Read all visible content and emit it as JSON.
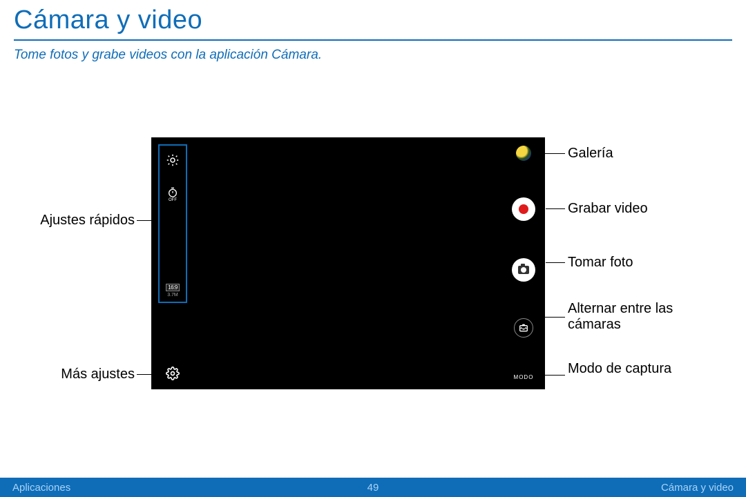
{
  "header": {
    "title": "Cámara y video",
    "subtitle": "Tome fotos y grabe videos con la aplicación Cámara."
  },
  "labels": {
    "quick_settings": "Ajustes rápidos",
    "more_settings": "Más ajustes",
    "gallery": "Galería",
    "record_video": "Grabar video",
    "take_photo": "Tomar foto",
    "switch_camera": "Alternar entre las cámaras",
    "capture_mode": "Modo de captura"
  },
  "screenshot": {
    "ratio": "16:9",
    "megapixels": "3.7M",
    "timer_text": "OFF",
    "mode_text": "MODO"
  },
  "footer": {
    "left": "Aplicaciones",
    "page": "49",
    "right": "Cámara y video"
  },
  "colors": {
    "brand_blue": "#0f6db8",
    "record_red": "#e01b1b"
  }
}
